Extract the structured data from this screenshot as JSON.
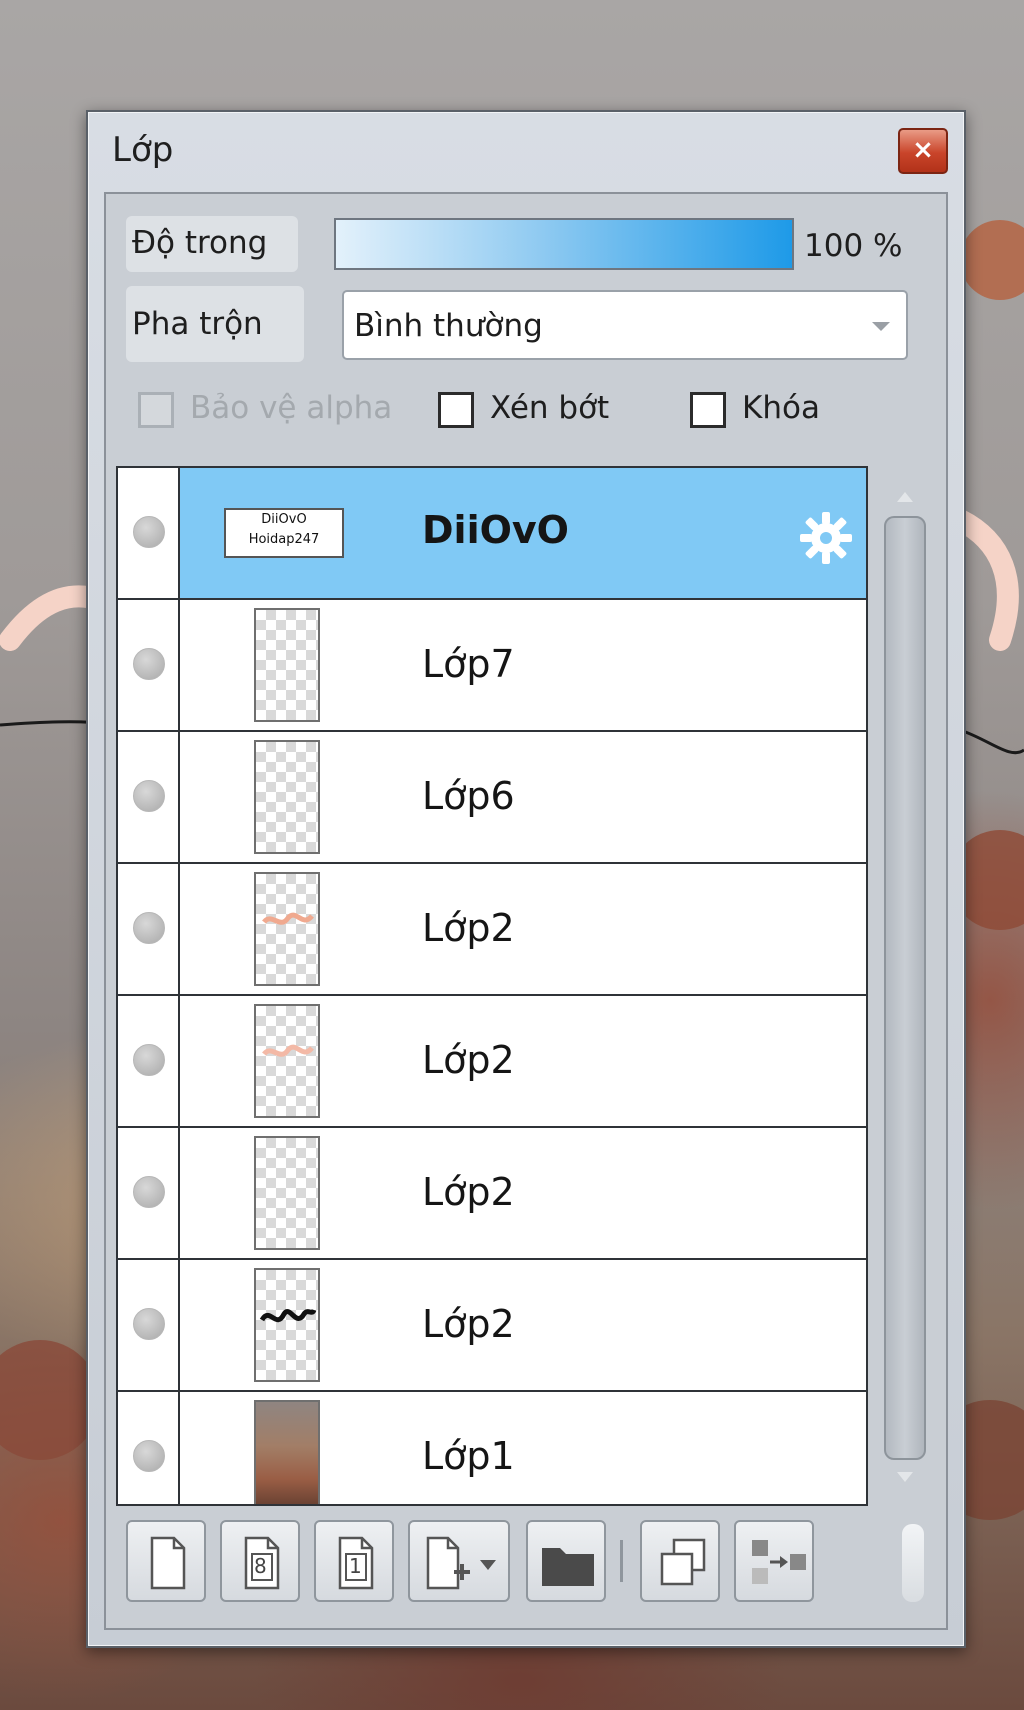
{
  "window": {
    "title": "Lớp",
    "close_label": "×"
  },
  "properties": {
    "opacity_label": "Độ trong",
    "opacity_percent": 100,
    "opacity_value": "100 %",
    "blend_label": "Pha trộn",
    "blend_value": "Bình thường"
  },
  "options": {
    "protect_alpha": {
      "label": "Bảo vệ alpha",
      "checked": false,
      "enabled": false
    },
    "clipping": {
      "label": "Xén bớt",
      "checked": false,
      "enabled": true
    },
    "lock": {
      "label": "Khóa",
      "checked": false,
      "enabled": true
    }
  },
  "layers": [
    {
      "name": "DiiOvO",
      "selected": true,
      "thumb_text": "DiiOvO Hoidap247",
      "has_settings_icon": true
    },
    {
      "name": "Lớp7",
      "selected": false
    },
    {
      "name": "Lớp6",
      "selected": false
    },
    {
      "name": "Lớp2",
      "selected": false
    },
    {
      "name": "Lớp2",
      "selected": false
    },
    {
      "name": "Lớp2",
      "selected": false
    },
    {
      "name": "Lớp2",
      "selected": false
    },
    {
      "name": "Lớp1",
      "selected": false
    }
  ],
  "toolbar": {
    "buttons": [
      {
        "icon": "new-layer-icon"
      },
      {
        "icon": "new-8bit-layer-icon",
        "label": "8"
      },
      {
        "icon": "new-1bit-layer-icon",
        "label": "1"
      },
      {
        "icon": "add-layer-menu-icon"
      },
      {
        "icon": "folder-icon"
      },
      {
        "icon": "duplicate-layer-icon"
      },
      {
        "icon": "merge-layer-icon"
      }
    ]
  },
  "colors": {
    "selected_row": "#80c9f5",
    "opacity_fill": "#1e9ae8",
    "close_button": "#c9442a"
  }
}
